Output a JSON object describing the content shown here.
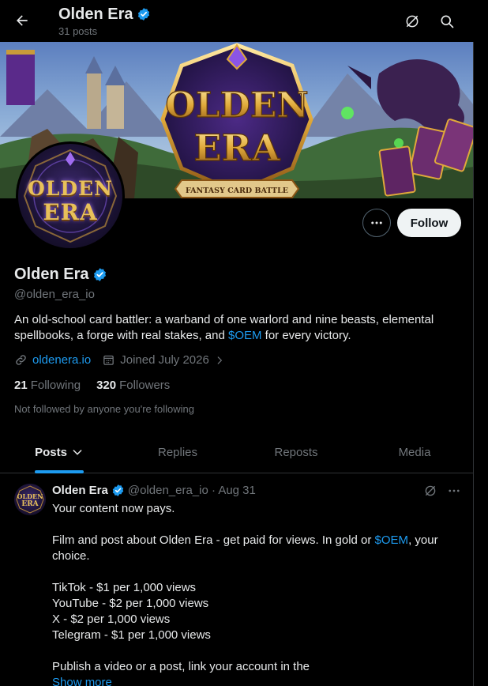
{
  "header": {
    "title": "Olden Era",
    "posts_count": "31 posts"
  },
  "banner": {
    "title_line1": "OLDEN",
    "title_line2": "ERA",
    "ribbon": "FANTASY CARD BATTLE"
  },
  "avatar": {
    "line1": "OLDEN",
    "line2": "ERA"
  },
  "actions": {
    "follow_label": "Follow"
  },
  "profile": {
    "name": "Olden Era",
    "handle": "@olden_era_io",
    "bio_text": "An old-school card battler: a warband of one warlord and nine beasts, elemental spellbooks, a forge with real stakes, and ",
    "bio_link": "$OEM",
    "bio_end": " for every victory.",
    "website": "oldenera.io",
    "joined": "Joined July 2026",
    "following_count": "21",
    "following_label": "Following",
    "followers_count": "320",
    "followers_label": "Followers",
    "not_followed": "Not followed by anyone you're following"
  },
  "tabs": [
    {
      "label": "Posts"
    },
    {
      "label": "Replies"
    },
    {
      "label": "Reposts"
    },
    {
      "label": "Media"
    }
  ],
  "post": {
    "author": "Olden Era",
    "handle_date": "@olden_era_io · Aug 31",
    "line1": "Your content now pays.",
    "line2_start": "Film and post about Olden Era - get paid for views. In gold or ",
    "line2_link": "$OEM",
    "line2_end": ", your",
    "line3": "choice.",
    "rate1": "TikTok - $1 per 1,000 views",
    "rate2": "YouTube - $2 per 1,000 views",
    "rate3": "X - $2 per 1,000 views",
    "rate4": "Telegram - $1 per 1,000 views",
    "line4": "Publish a video or a post, link your account in the",
    "show_more": "Show more"
  },
  "colors": {
    "accent": "#1d9bf0",
    "background": "#000000",
    "text": "#e7e9ea",
    "muted": "#71767b"
  },
  "icons": [
    "back-arrow-icon",
    "grok-icon",
    "search-icon",
    "verified-badge-icon",
    "more-icon",
    "link-icon",
    "calendar-icon",
    "chevron-right-icon",
    "chevron-down-icon"
  ]
}
